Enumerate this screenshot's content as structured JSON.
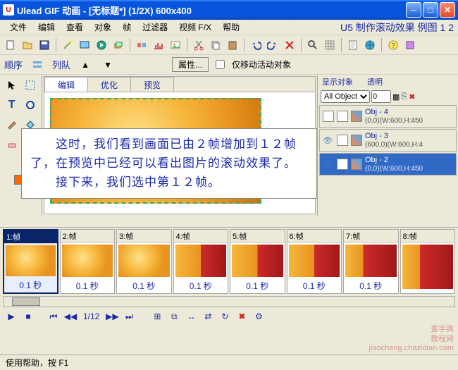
{
  "app": {
    "title": "Ulead GIF 动画 - [无标题*] (1/2X)   600x400",
    "headerText": "U5  制作滚动效果  例图 1  2"
  },
  "menu": {
    "file": "文件",
    "edit": "编辑",
    "view": "查看",
    "object": "对象",
    "frame": "帧",
    "filter": "过滤器",
    "videofx": "视频 F/X",
    "help": "帮助"
  },
  "seq": {
    "order": "顺序",
    "queue": "列队",
    "props": "属性...",
    "movecheck": "仅移动活动对象"
  },
  "canvas": {
    "tabs": {
      "edit": "编辑",
      "optimize": "优化",
      "preview": "预览"
    }
  },
  "rightpanel": {
    "display": "显示对象",
    "transparent": "透明",
    "allobjects": "All Object:",
    "zero": "0",
    "objects": [
      {
        "name": "Obj - 4",
        "coord": "(0,0)(W:600,H:450"
      },
      {
        "name": "Obj - 3",
        "coord": "(600,0)(W:600,H:4"
      },
      {
        "name": "Obj - 2",
        "coord": "(0,0)(W:600,H:450"
      }
    ]
  },
  "overlay": {
    "line1": "　　这时，我们看到画面已由２帧增加到１２帧了，在预览中已经可以看出图片的滚动效果了。",
    "line2": "　　接下来，我们选中第１２帧。"
  },
  "timeline": {
    "frames": [
      {
        "label": "1:帧",
        "dur": "0.1 秒",
        "sel": true,
        "type": ""
      },
      {
        "label": "2:帧",
        "dur": "0.1 秒",
        "sel": false,
        "type": ""
      },
      {
        "label": "3:帧",
        "dur": "0.1 秒",
        "sel": false,
        "type": ""
      },
      {
        "label": "4:帧",
        "dur": "0.1 秒",
        "sel": false,
        "type": "mix"
      },
      {
        "label": "5:帧",
        "dur": "0.1 秒",
        "sel": false,
        "type": "mix"
      },
      {
        "label": "6:帧",
        "dur": "0.1 秒",
        "sel": false,
        "type": "mix"
      },
      {
        "label": "7:帧",
        "dur": "0.1 秒",
        "sel": false,
        "type": "mix2"
      },
      {
        "label": "8:帧",
        "dur": "",
        "sel": false,
        "type": "mix2"
      }
    ],
    "counter": "1/12"
  },
  "status": {
    "help": "使用帮助，按 F1"
  },
  "watermark": {
    "l1": "查字典",
    "l2": "教程网",
    "l3": "jiaocheng.chazidian.com"
  }
}
